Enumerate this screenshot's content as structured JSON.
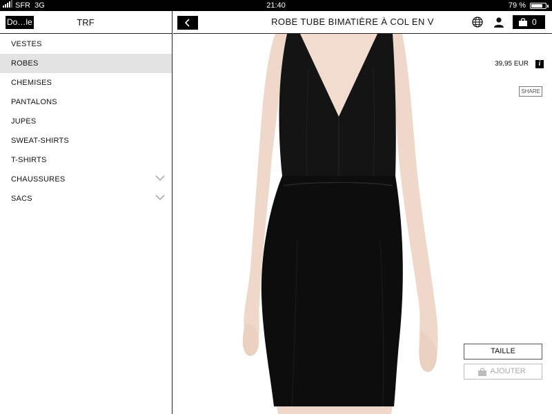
{
  "status_bar": {
    "carrier": "SFR",
    "network": "3G",
    "time": "21:40",
    "battery_percent": "79 %",
    "battery_level": 0.79
  },
  "sidebar": {
    "done_label": "Do…le",
    "title": "TRF",
    "items": [
      {
        "label": "VESTES",
        "active": false,
        "expandable": false
      },
      {
        "label": "ROBES",
        "active": true,
        "expandable": false
      },
      {
        "label": "CHEMISES",
        "active": false,
        "expandable": false
      },
      {
        "label": "PANTALONS",
        "active": false,
        "expandable": false
      },
      {
        "label": "JUPES",
        "active": false,
        "expandable": false
      },
      {
        "label": "SWEAT-SHIRTS",
        "active": false,
        "expandable": false
      },
      {
        "label": "T-SHIRTS",
        "active": false,
        "expandable": false
      },
      {
        "label": "CHAUSSURES",
        "active": false,
        "expandable": true
      },
      {
        "label": "SACS",
        "active": false,
        "expandable": true
      }
    ]
  },
  "product": {
    "title": "ROBE TUBE BIMATIÈRE À COL EN V",
    "price": "39,95 EUR",
    "info_glyph": "i",
    "share_label": "SHARE",
    "size_button_label": "TAILLE",
    "add_button_label": "AJOUTER"
  },
  "header_icons": {
    "back": "chevron-left-icon",
    "language": "globe-icon",
    "account": "user-icon",
    "cart": "shopping-bag-icon",
    "cart_count": "0"
  },
  "colors": {
    "active_item_bg": "#e3e3e3",
    "dress": "#111111",
    "skin": "#f0d9cc",
    "black": "#000000"
  }
}
